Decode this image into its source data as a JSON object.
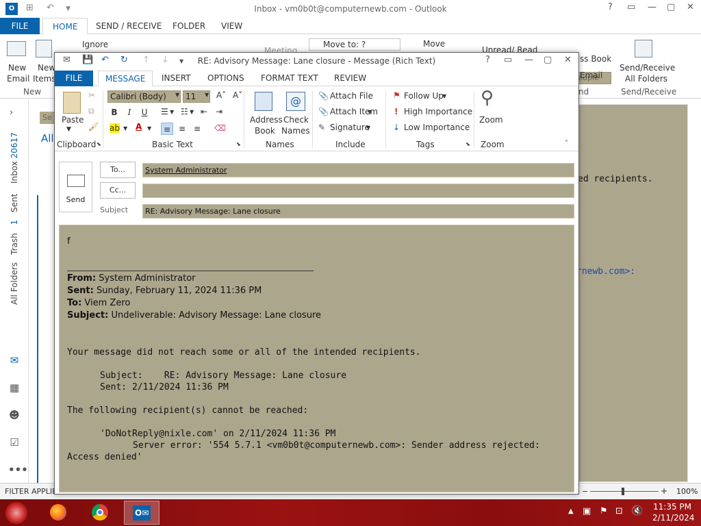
{
  "main_window": {
    "title": "Inbox - vm0b0t@computernewb.com - Outlook",
    "app_icon_label": "O",
    "tabs": [
      "FILE",
      "HOME",
      "SEND / RECEIVE",
      "FOLDER",
      "VIEW"
    ],
    "active_tab": "HOME",
    "ribbon": {
      "new_email": "New Email",
      "new_email_l1": "New",
      "new_email_l2": "Email",
      "new_items_l1": "New",
      "new_items_l2": "Items",
      "new_group": "New",
      "ignore": "Ignore",
      "meeting": "Meeting",
      "move_to": "Move to: ?",
      "move": "Move",
      "unread_read": "Unread/ Read",
      "search_people_placeholder": "Search People",
      "address_book_partial": "ss Book",
      "filter_email_partial": "Email",
      "find_group_partial": "nd",
      "send_receive_l1": "Send/Receive",
      "send_receive_l2": "All Folders",
      "send_receive_group": "Send/Receive"
    },
    "left_nav": {
      "inbox_label": "Inbox",
      "inbox_count": "20617",
      "sent_label": "Sent",
      "trash_label": "Trash",
      "trash_count": "1",
      "all_folders": "All Folders",
      "icons": [
        "mail-icon",
        "calendar-icon",
        "people-icon",
        "tasks-icon",
        "more-icon"
      ]
    },
    "list_partial": {
      "search_partial": "Se",
      "all_partial": "All"
    },
    "reading_pane": {
      "text_1": "ed recipients.",
      "text_2": "rnewb.com>:"
    },
    "status": {
      "filter": "FILTER APPLIED",
      "zoom": "100%"
    }
  },
  "compose_window": {
    "title": "RE: Advisory Message: Lane closure - Message (Rich Text)",
    "tabs": [
      "FILE",
      "MESSAGE",
      "INSERT",
      "OPTIONS",
      "FORMAT TEXT",
      "REVIEW"
    ],
    "active_tab": "MESSAGE",
    "ribbon": {
      "paste": "Paste",
      "clipboard_group": "Clipboard",
      "font_name": "Calibri (Body)",
      "font_size": "11",
      "bold": "B",
      "italic": "I",
      "underline": "U",
      "basic_text_group": "Basic Text",
      "address_book_l1": "Address",
      "address_book_l2": "Book",
      "check_names_l1": "Check",
      "check_names_l2": "Names",
      "names_group": "Names",
      "attach_file": "Attach File",
      "attach_item": "Attach Item",
      "signature": "Signature",
      "include_group": "Include",
      "follow_up": "Follow Up",
      "high_importance": "High Importance",
      "low_importance": "Low Importance",
      "tags_group": "Tags",
      "zoom": "Zoom",
      "zoom_group": "Zoom"
    },
    "header": {
      "send_label": "Send",
      "to_button": "To...",
      "cc_button": "Cc...",
      "subject_label": "Subject",
      "to_value": "System Administrator",
      "cc_value": "",
      "subject_value": "RE: Advisory Message: Lane closure"
    },
    "body": {
      "typed_text": "f",
      "from_label": "From:",
      "from_value": "System Administrator",
      "sent_label": "Sent:",
      "sent_value": "Sunday, February 11, 2024 11:36 PM",
      "to_label": "To:",
      "to_value": "Viem Zero",
      "subject_label": "Subject:",
      "subject_value": "Undeliverable: Advisory Message: Lane closure",
      "line_1": "Your message did not reach some or all of the intended recipients.",
      "line_2": "Subject:    RE: Advisory Message: Lane closure",
      "line_3": "Sent: 2/11/2024 11:36 PM",
      "line_4": "The following recipient(s) cannot be reached:",
      "line_5": "'DoNotReply@nixle.com' on 2/11/2024 11:36 PM",
      "line_6": "Server error: '554 5.7.1 <vm0b0t@computernewb.com>: Sender address rejected:",
      "line_7": "Access denied'"
    }
  },
  "taskbar": {
    "time": "11:35 PM",
    "date": "2/11/2024",
    "apps": [
      "firefox-icon",
      "chrome-icon",
      "outlook-icon"
    ]
  },
  "colors": {
    "accent": "#0a64ad",
    "field_bg": "#aca68d",
    "taskbar": "#8a0e0e"
  }
}
